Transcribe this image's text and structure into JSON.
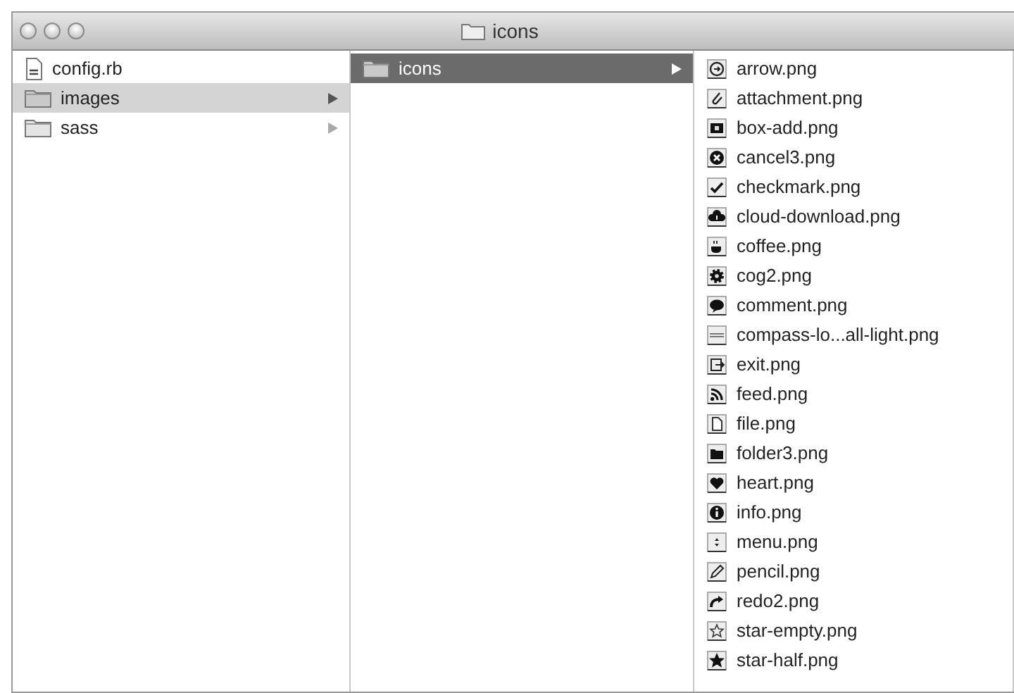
{
  "window": {
    "title": "icons"
  },
  "columns": [
    {
      "focused": false,
      "items": [
        {
          "name": "config.rb",
          "kind": "file",
          "selected": false
        },
        {
          "name": "images",
          "kind": "folder",
          "selected": true
        },
        {
          "name": "sass",
          "kind": "folder",
          "selected": false
        }
      ]
    },
    {
      "focused": true,
      "items": [
        {
          "name": "icons",
          "kind": "folder",
          "selected": true
        }
      ]
    },
    {
      "items": [
        {
          "name": "arrow.png",
          "kind": "image",
          "selected": false
        },
        {
          "name": "attachment.png",
          "kind": "image",
          "selected": false
        },
        {
          "name": "box-add.png",
          "kind": "image",
          "selected": false
        },
        {
          "name": "cancel3.png",
          "kind": "image",
          "selected": false
        },
        {
          "name": "checkmark.png",
          "kind": "image",
          "selected": false
        },
        {
          "name": "cloud-download.png",
          "kind": "image",
          "selected": false
        },
        {
          "name": "coffee.png",
          "kind": "image",
          "selected": false
        },
        {
          "name": "cog2.png",
          "kind": "image",
          "selected": false
        },
        {
          "name": "comment.png",
          "kind": "image",
          "selected": false
        },
        {
          "name": "compass-lo...all-light.png",
          "kind": "image",
          "selected": false
        },
        {
          "name": "exit.png",
          "kind": "image",
          "selected": false
        },
        {
          "name": "feed.png",
          "kind": "image",
          "selected": false
        },
        {
          "name": "file.png",
          "kind": "image",
          "selected": false
        },
        {
          "name": "folder3.png",
          "kind": "image",
          "selected": false
        },
        {
          "name": "heart.png",
          "kind": "image",
          "selected": false
        },
        {
          "name": "info.png",
          "kind": "image",
          "selected": false
        },
        {
          "name": "menu.png",
          "kind": "image",
          "selected": false
        },
        {
          "name": "pencil.png",
          "kind": "image",
          "selected": false
        },
        {
          "name": "redo2.png",
          "kind": "image",
          "selected": false
        },
        {
          "name": "star-empty.png",
          "kind": "image",
          "selected": false
        },
        {
          "name": "star-half.png",
          "kind": "image",
          "selected": false
        }
      ]
    }
  ]
}
